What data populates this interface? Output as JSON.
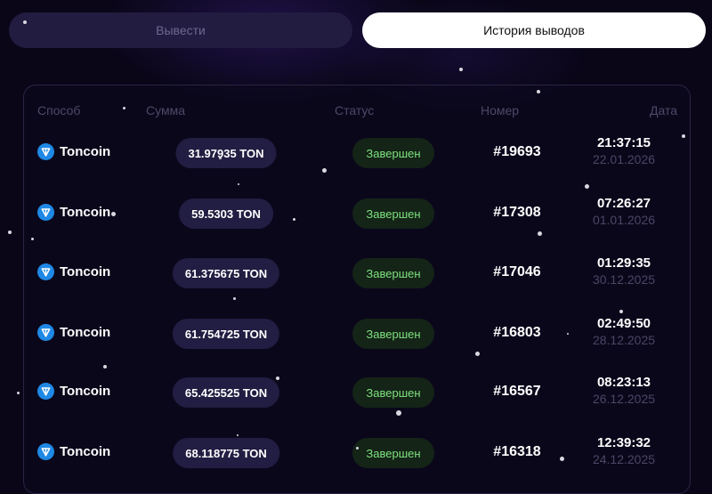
{
  "tabs": {
    "withdraw": "Вывести",
    "history": "История выводов"
  },
  "table": {
    "headers": {
      "method": "Способ",
      "amount": "Сумма",
      "status": "Статус",
      "number": "Номер",
      "date": "Дата"
    },
    "rows": [
      {
        "method": "Toncoin",
        "amount": "31.97935 TON",
        "status": "Завершен",
        "number": "#19693",
        "time": "21:37:15",
        "date": "22.01.2026"
      },
      {
        "method": "Toncoin",
        "amount": "59.5303 TON",
        "status": "Завершен",
        "number": "#17308",
        "time": "07:26:27",
        "date": "01.01.2026"
      },
      {
        "method": "Toncoin",
        "amount": "61.375675 TON",
        "status": "Завершен",
        "number": "#17046",
        "time": "01:29:35",
        "date": "30.12.2025"
      },
      {
        "method": "Toncoin",
        "amount": "61.754725 TON",
        "status": "Завершен",
        "number": "#16803",
        "time": "02:49:50",
        "date": "28.12.2025"
      },
      {
        "method": "Toncoin",
        "amount": "65.425525 TON",
        "status": "Завершен",
        "number": "#16567",
        "time": "08:23:13",
        "date": "26.12.2025"
      },
      {
        "method": "Toncoin",
        "amount": "68.118775 TON",
        "status": "Завершен",
        "number": "#16318",
        "time": "12:39:32",
        "date": "24.12.2025"
      }
    ]
  },
  "icons": {
    "method": "toncoin-icon"
  },
  "colors": {
    "background": "#0a0618",
    "status_text": "#7ee27e",
    "status_bg": "#142417",
    "ton_blue": "#1e88e5",
    "active_tab": "#ffffff"
  }
}
